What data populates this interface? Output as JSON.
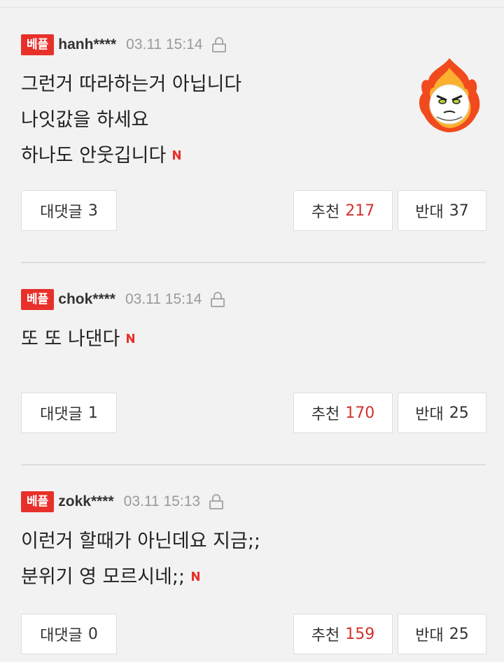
{
  "comments": [
    {
      "badge": "베플",
      "username": "hanh****",
      "timestamp": "03.11 15:14",
      "lines": [
        "그런거 따라하는거 아닙니다",
        "나잇값을 하세요",
        "하나도 안웃깁니다"
      ],
      "reply_label": "대댓글",
      "reply_count": "3",
      "up_label": "추천",
      "up_count": "217",
      "down_label": "반대",
      "down_count": "37"
    },
    {
      "badge": "베플",
      "username": "chok****",
      "timestamp": "03.11 15:14",
      "lines": [
        "또 또 나댄다"
      ],
      "reply_label": "대댓글",
      "reply_count": "1",
      "up_label": "추천",
      "up_count": "170",
      "down_label": "반대",
      "down_count": "25"
    },
    {
      "badge": "베플",
      "username": "zokk****",
      "timestamp": "03.11 15:13",
      "lines": [
        "이런거 할때가 아닌데요 지금;;",
        "분위기 영 모르시네;;"
      ],
      "reply_label": "대댓글",
      "reply_count": "0",
      "up_label": "추천",
      "up_count": "159",
      "down_label": "반대",
      "down_count": "25"
    }
  ],
  "colors": {
    "badge": "#e8302a",
    "up_count": "#d2322d",
    "new_icon": "#e8302a",
    "background": "#f2f2f2"
  },
  "icons": {
    "lock": "lock-icon",
    "new": "new-n-icon",
    "avatar": "flame-mascot-avatar"
  }
}
